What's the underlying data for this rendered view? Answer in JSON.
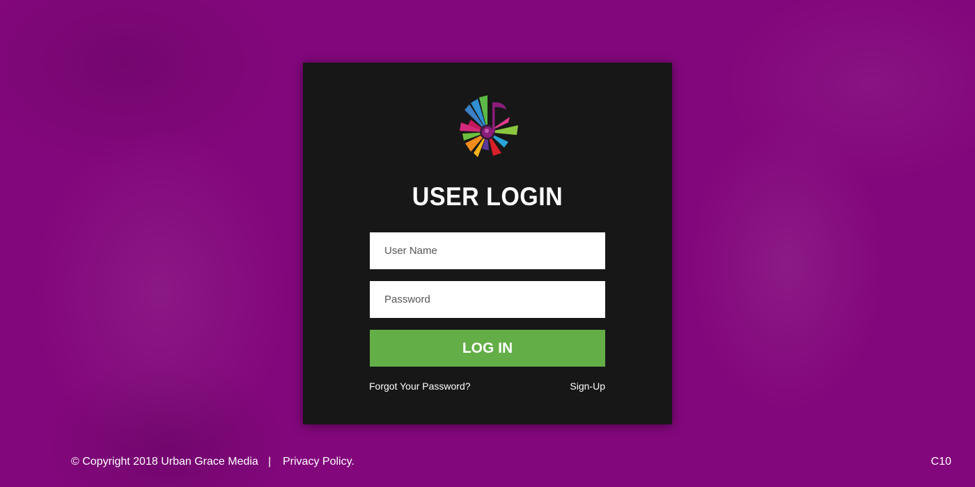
{
  "brand": {
    "logo_icon": "music-note-burst-logo-icon",
    "colors": {
      "background": "#82077c",
      "card": "#171717",
      "button": "#63ae47",
      "note": "#8b1d7a"
    }
  },
  "login": {
    "title": "USER LOGIN",
    "username_placeholder": "User Name",
    "username_value": "",
    "password_placeholder": "Password",
    "password_value": "",
    "button_label": "LOG IN",
    "forgot_label": "Forgot Your Password?",
    "signup_label": "Sign-Up"
  },
  "footer": {
    "copyright": "© Copyright 2018 Urban Grace Media",
    "separator": "|",
    "privacy_label": "Privacy Policy.",
    "code": "C10"
  }
}
